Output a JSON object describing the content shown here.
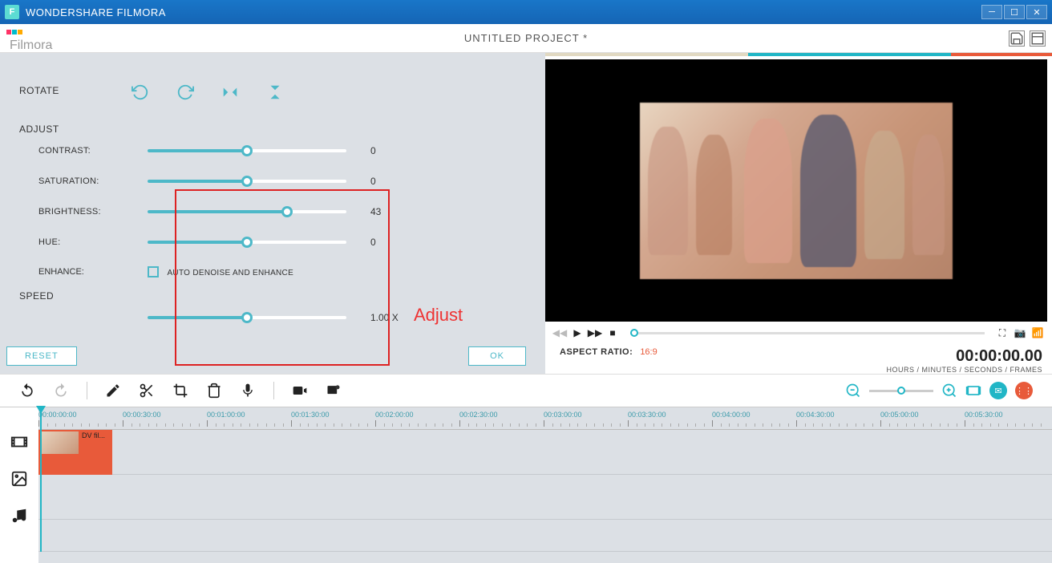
{
  "titlebar": {
    "app_name": "WONDERSHARE FILMORA"
  },
  "header": {
    "logo_text": "Filmora",
    "project_title": "UNTITLED PROJECT *"
  },
  "adjust": {
    "rotate_label": "ROTATE",
    "adjust_label": "ADJUST",
    "speed_label": "SPEED",
    "contrast": {
      "label": "CONTRAST:",
      "value": "0",
      "pct": 50
    },
    "saturation": {
      "label": "SATURATION:",
      "value": "0",
      "pct": 50
    },
    "brightness": {
      "label": "BRIGHTNESS:",
      "value": "43",
      "pct": 70
    },
    "hue": {
      "label": "HUE:",
      "value": "0",
      "pct": 50
    },
    "enhance_label": "ENHANCE:",
    "enhance_text": "AUTO DENOISE AND ENHANCE",
    "speed_value": "1.00 X",
    "speed_pct": 50,
    "reset": "RESET",
    "ok": "OK",
    "annotation": "Adjust"
  },
  "preview": {
    "aspect_label": "ASPECT RATIO:",
    "aspect_value": "16:9",
    "timecode": "00:00:00.00",
    "timecode_sub": "HOURS / MINUTES / SECONDS / FRAMES"
  },
  "timeline": {
    "marks": [
      "00:00:00:00",
      "00:00:30:00",
      "00:01:00:00",
      "00:01:30:00",
      "00:02:00:00",
      "00:02:30:00",
      "00:03:00:00",
      "00:03:30:00",
      "00:04:00:00",
      "00:04:30:00",
      "00:05:00:00",
      "00:05:30:00"
    ],
    "clip_label": "DV fil..."
  }
}
